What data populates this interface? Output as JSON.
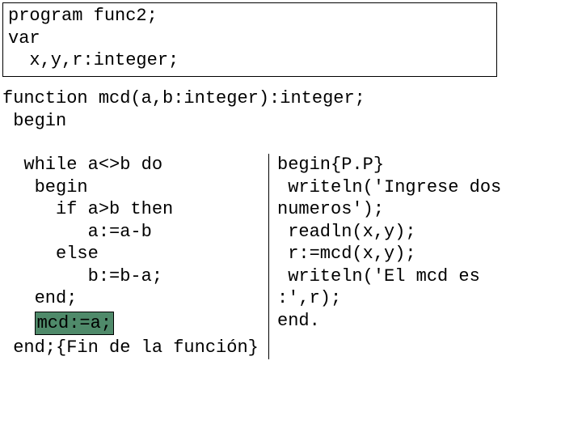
{
  "header": {
    "l1": "program func2;",
    "l2": "var",
    "l3": "  x,y,r:integer;"
  },
  "funcDecl": {
    "l1": "function mcd(a,b:integer):integer;",
    "l2": " begin"
  },
  "left": {
    "l1": "  while a<>b do",
    "l2": "   begin",
    "l3": "     if a>b then",
    "l4": "        a:=a-b",
    "l5": "     else",
    "l6": "        b:=b-a;",
    "l7": "   end;",
    "l8pre": "   ",
    "l8hl": "mcd:=a;",
    "l9": " end;{Fin de la función}"
  },
  "right": {
    "l1": "begin{P.P}",
    "l2": " writeln('Ingrese dos",
    "l3": "numeros');",
    "l4": " readln(x,y);",
    "l5": " r:=mcd(x,y);",
    "l6": " writeln('El mcd es",
    "l7": ":',r);",
    "l8": "end."
  }
}
